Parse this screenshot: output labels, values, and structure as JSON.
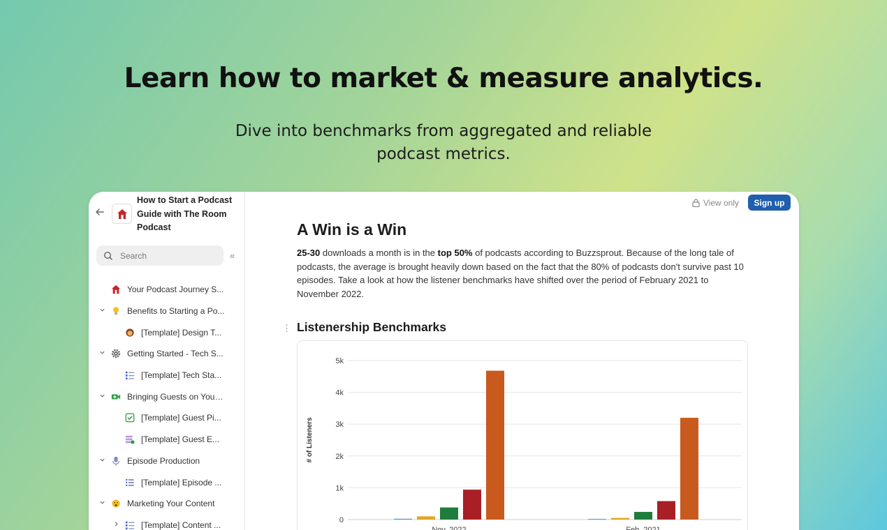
{
  "hero": {
    "title": "Learn how to market & measure analytics.",
    "subtitle": "Dive into benchmarks from aggregated and reliable podcast metrics."
  },
  "sidebar": {
    "workspace_title": "How to Start a Podcast Guide with The Room Podcast",
    "search_placeholder": "Search",
    "items": [
      {
        "label": "Your Podcast Journey S...",
        "level": 0,
        "chevron": "",
        "icon": "house-icon"
      },
      {
        "label": "Benefits to Starting a Po...",
        "level": 0,
        "chevron": "down",
        "icon": "lightbulb-icon"
      },
      {
        "label": "[Template] Design T...",
        "level": 1,
        "chevron": "",
        "icon": "person-icon"
      },
      {
        "label": "Getting Started - Tech S...",
        "level": 0,
        "chevron": "down",
        "icon": "gear-icon"
      },
      {
        "label": "[Template] Tech Sta...",
        "level": 1,
        "chevron": "",
        "icon": "checklist-icon"
      },
      {
        "label": "Bringing Guests on Your ...",
        "level": 0,
        "chevron": "down",
        "icon": "video-camera-icon"
      },
      {
        "label": "[Template] Guest Pi...",
        "level": 1,
        "chevron": "",
        "icon": "checkbox-icon"
      },
      {
        "label": "[Template] Guest E...",
        "level": 1,
        "chevron": "",
        "icon": "database-check-icon"
      },
      {
        "label": "Episode Production",
        "level": 0,
        "chevron": "down",
        "icon": "microphone-icon"
      },
      {
        "label": "[Template] Episode ...",
        "level": 1,
        "chevron": "",
        "icon": "list-icon"
      },
      {
        "label": "Marketing Your Content",
        "level": 0,
        "chevron": "down",
        "icon": "megaphone-face-icon"
      },
      {
        "label": "[Template] Content ...",
        "level": 1,
        "chevron": "right",
        "icon": "checklist-icon"
      }
    ]
  },
  "topbar": {
    "view_only": "View only",
    "signup": "Sign up"
  },
  "doc": {
    "title": "A Win is a Win",
    "para_bold1": "25-30",
    "para_text1": " downloads a month is in the ",
    "para_bold2": "top 50%",
    "para_text2": " of podcasts according to Buzzsprout. Because of the long tale of podcasts, the average is brought heavily down based on the fact that the 80% of podcasts don't survive past 10 episodes. Take a look at how the listener benchmarks have shifted over the period of February 2021 to November 2022.",
    "section_title": "Listenership Benchmarks"
  },
  "chart_data": {
    "type": "bar",
    "categories": [
      "Nov. 2022",
      "Feb. 2021"
    ],
    "series": [
      {
        "color": "#5b8fd6",
        "values": [
          25,
          20
        ]
      },
      {
        "color": "#e0a623",
        "values": [
          100,
          50
        ]
      },
      {
        "color": "#1e7d3c",
        "values": [
          380,
          240
        ]
      },
      {
        "color": "#a82025",
        "values": [
          940,
          580
        ]
      },
      {
        "color": "#c95a1e",
        "values": [
          4680,
          3200
        ]
      }
    ],
    "ylabel": "# of Listeners",
    "ylim": [
      0,
      5000
    ],
    "yticks": [
      "0",
      "1k",
      "2k",
      "3k",
      "4k",
      "5k"
    ],
    "grid": true
  }
}
